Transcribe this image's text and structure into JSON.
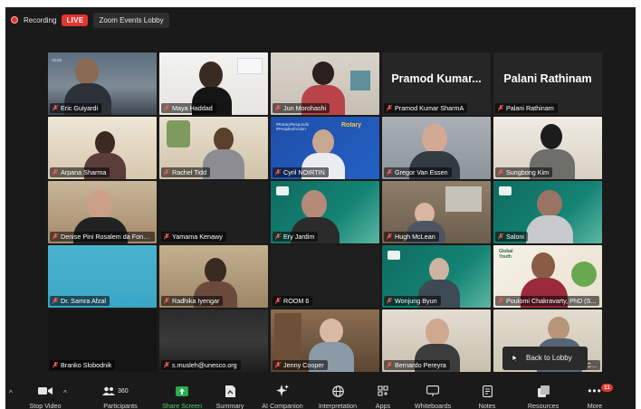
{
  "top": {
    "recording_label": "Recording",
    "live_label": "LIVE",
    "lobby_label": "Zoom Events Lobby"
  },
  "tiles": [
    {
      "name": "Eric Guiyardi",
      "active": true
    },
    {
      "name": "Maya Haddad"
    },
    {
      "name": "Jun Morohashi"
    },
    {
      "name": "Pramod Kumar SharmA",
      "big": "Pramod  Kumar..."
    },
    {
      "name": "Palani Rathinam",
      "big": "Palani Rathinam"
    },
    {
      "name": "Arpana Sharma"
    },
    {
      "name": "Rachel Tidd"
    },
    {
      "name": "Cyril NOIRTIN"
    },
    {
      "name": "Gregor Van Essen"
    },
    {
      "name": "Sungbong Kim"
    },
    {
      "name": "Denise Pini Rosalem da Fons..."
    },
    {
      "name": "Yamama Kenawy"
    },
    {
      "name": "Ery Jardim"
    },
    {
      "name": "Hugh McLean"
    },
    {
      "name": "Saloni"
    },
    {
      "name": "Dr. Samra Afzal"
    },
    {
      "name": "Radhika Iyengar"
    },
    {
      "name": "ROOM 6"
    },
    {
      "name": "Wonjung Byun"
    },
    {
      "name": "Poulomi Chakravarty, PhD (S..."
    },
    {
      "name": "Branko Slobodnik"
    },
    {
      "name": "s.musleh@unesco.org"
    },
    {
      "name": "Jenny Cooper"
    },
    {
      "name": "Bernardo Pereyra"
    },
    {
      "name": "...C..."
    }
  ],
  "toolbar": {
    "stop_video": "Stop Video",
    "participants": "Participants",
    "participants_count": "360",
    "share_screen": "Share Screen",
    "summary": "Summary",
    "ai_companion": "AI Companion",
    "interpretation": "Interpretation",
    "apps": "Apps",
    "whiteboards": "Whiteboards",
    "notes": "Notes",
    "resources": "Resources",
    "more": "More",
    "more_badge": "11"
  },
  "back_to_lobby": "Back to Lobby",
  "colors": {
    "live_red": "#e2352d",
    "share_green": "#4dd36b",
    "active_outline": "#c8e07a"
  }
}
